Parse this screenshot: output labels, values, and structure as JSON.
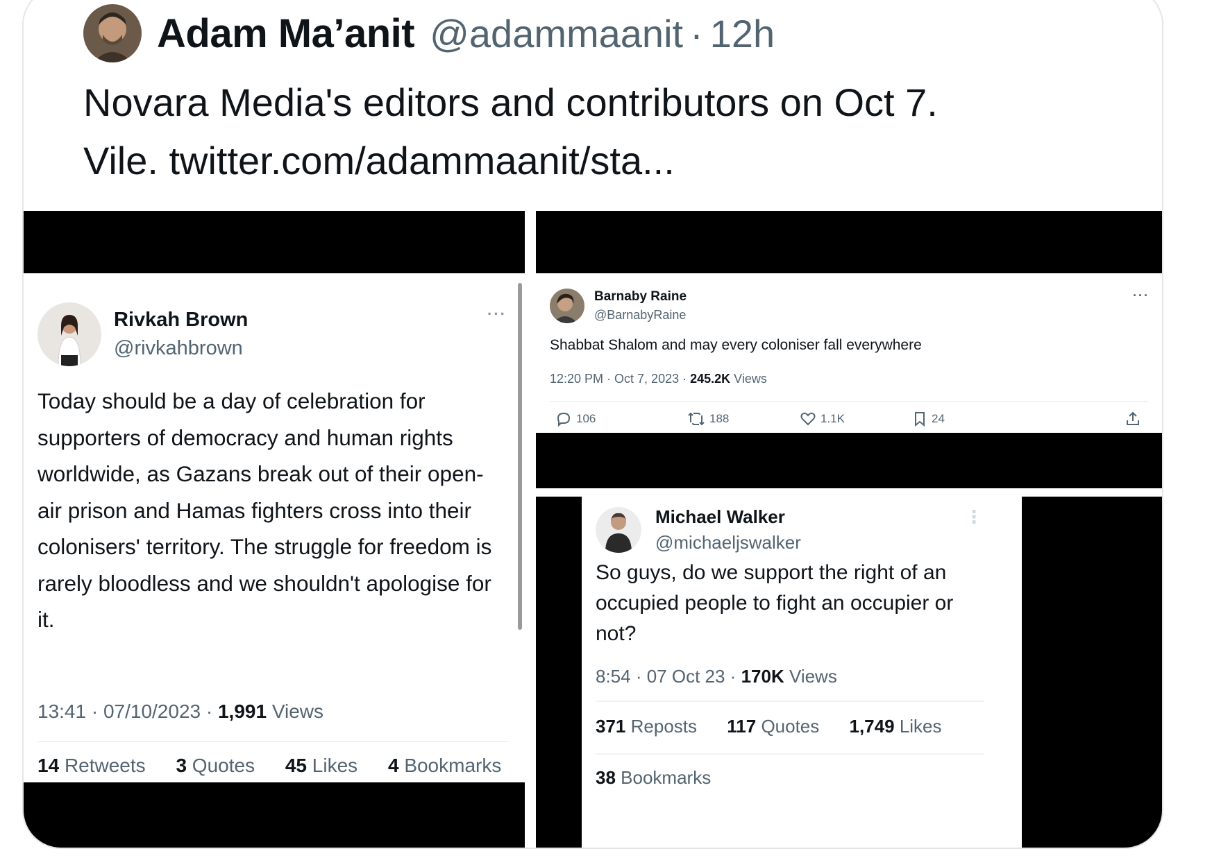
{
  "main_tweet": {
    "author_name": "Adam Ma’anit",
    "handle": "@adammaanit",
    "separator": "·",
    "time": "12h",
    "text_line1": "Novara Media's editors and contributors on Oct 7.",
    "text_line2": "Vile. twitter.com/adammaanit/sta..."
  },
  "tweet_rivkah": {
    "name": "Rivkah Brown",
    "handle": "@rivkahbrown",
    "more": "···",
    "lines": [
      "Today should be a day of celebration for",
      "supporters of democracy and human rights",
      "worldwide, as Gazans break out of their open-",
      "air prison and Hamas fighters cross into their",
      "colonisers' territory. The struggle for freedom is",
      "rarely bloodless and we shouldn't apologise for",
      "it."
    ],
    "meta_time": "13:41 · 07/10/2023 · ",
    "views_count": "1,991",
    "views_label": " Views",
    "stats": [
      {
        "count": "14",
        "label": "Retweets"
      },
      {
        "count": "3",
        "label": "Quotes"
      },
      {
        "count": "45",
        "label": "Likes"
      },
      {
        "count": "4",
        "label": "Bookmarks"
      }
    ]
  },
  "tweet_barnaby": {
    "name": "Barnaby Raine",
    "handle": "@BarnabyRaine",
    "more": "···",
    "text": "Shabbat Shalom and may every coloniser fall everywhere",
    "meta_time": "12:20 PM · Oct 7, 2023 · ",
    "views_count": "245.2K",
    "views_label": " Views",
    "actions": {
      "replies": "106",
      "reposts": "188",
      "likes": "1.1K",
      "bookmarks": "24"
    }
  },
  "tweet_michael": {
    "name": "Michael Walker",
    "handle": "@michaeljswalker",
    "more": "⋮",
    "lines": [
      "So guys, do we support the right of an",
      "occupied people to fight an occupier or",
      "not?"
    ],
    "meta_time": "8:54 · 07 Oct 23 · ",
    "views_count": "170K",
    "views_label": " Views",
    "stats": [
      {
        "count": "371",
        "label": "Reposts"
      },
      {
        "count": "117",
        "label": "Quotes"
      },
      {
        "count": "1,749",
        "label": "Likes"
      }
    ],
    "bookmarks_count": "38",
    "bookmarks_label": "Bookmarks"
  }
}
